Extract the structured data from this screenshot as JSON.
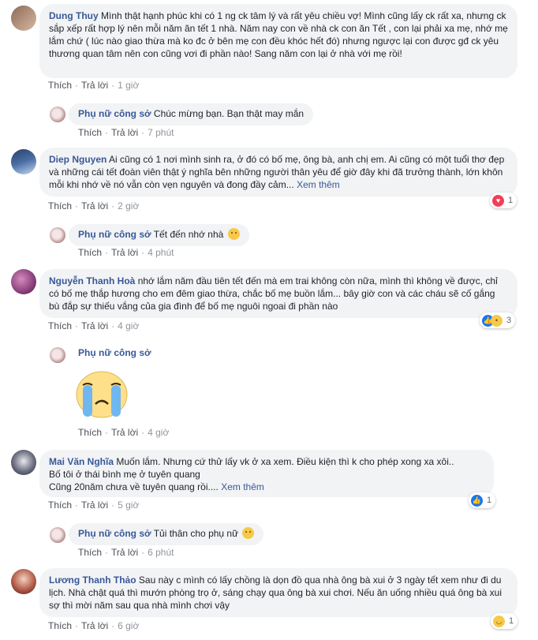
{
  "comments": [
    {
      "name": "Dung Thuy",
      "text": "Mình thật hạnh phúc khi có 1 ng ck tâm lý và rất yêu chiều vợ! Mình cũng lấy ck rất xa, nhưng ck sắp xếp rất hợp lý nên mỗi năm ăn tết 1 nhà. Năm nay con về nhà ck con ăn Tết , con lại phải xa mẹ, nhớ mẹ lắm chứ ( lúc nào giao thừa mà ko đc ở bên mẹ con đều khóc hết đó) nhưng ngược lại con được gđ ck yêu thương quan tâm nên con cũng vơi đi phần nào! Sang năm con lại ở nhà với mẹ rồi!",
      "like": "Thích",
      "reply": "Trả lời",
      "time": "1 giờ"
    },
    {
      "name": "Phụ nữ công sở",
      "text": "Chúc mừng bạn. Bạn thật may mắn",
      "like": "Thích",
      "reply": "Trả lời",
      "time": "7 phút"
    },
    {
      "name": "Diep Nguyen",
      "text": "Ai cũng có 1 nơi mình sinh ra, ở đó có bố mẹ, ông bà, anh chị em. Ai cũng có một tuổi thơ đẹp và những cái tết đoàn viên thật ý nghĩa bên những người thân yêu để giờ đây khi đã trưởng thành, lớn khôn mỗi khi nhớ về nó vẫn còn vẹn nguyên và đong đầy cảm...",
      "more": "Xem thêm",
      "like": "Thích",
      "reply": "Trả lời",
      "time": "2 giờ",
      "reaction_count": "1"
    },
    {
      "name": "Phụ nữ công sở",
      "text": "Tết đến nhớ nhà",
      "like": "Thích",
      "reply": "Trả lời",
      "time": "4 phút"
    },
    {
      "name": "Nguyễn Thanh Hoà",
      "text": "nhớ lắm năm đầu tiên tết đến mà em trai không còn nữa, mình thì không về được, chỉ có bố mẹ thắp hương cho em đêm giao thừa, chắc bố mẹ buồn lắm... bây giờ con và các cháu sẽ cố gắng bù đắp sự thiếu vắng của gia đình để bố mẹ nguôi ngoai đi phần nào",
      "like": "Thích",
      "reply": "Trả lời",
      "time": "4 giờ",
      "reaction_count": "3"
    },
    {
      "name": "Phụ nữ công sở",
      "like": "Thích",
      "reply": "Trả lời",
      "time": "4 giờ"
    },
    {
      "name": "Mai Văn Nghĩa",
      "line1": "Muốn lắm. Nhưng cứ thử lấy vk ở xa xem. Điều kiện thì k cho phép xong xa xôi..",
      "line2": "Bố tôi ở thái bình mẹ ở tuyên quang",
      "line3": "Cũng 20năm chưa về tuyên quang rồi....",
      "more": "Xem thêm",
      "like": "Thích",
      "reply": "Trả lời",
      "time": "5 giờ",
      "reaction_count": "1"
    },
    {
      "name": "Phụ nữ công sở",
      "text": "Tủi thân cho phụ nữ",
      "like": "Thích",
      "reply": "Trả lời",
      "time": "6 phút"
    },
    {
      "name": "Lương Thanh Thảo",
      "text": "Sau này c mình có lấy chồng là dọn đồ qua nhà ông bà xui ở 3 ngày tết xem như đi du lịch. Nhà chật quá thì mướn phòng trọ ở, sáng chạy qua ông bà xui chơi. Nếu ăn uống nhiều quá ông bà xui sợ thì mời năm sau qua nhà mình chơi vậy",
      "like": "Thích",
      "reply": "Trả lời",
      "time": "6 giờ",
      "reaction_count": "1"
    }
  ],
  "icons": {
    "heart": "heart-reaction-icon",
    "like": "like-reaction-icon",
    "sad": "sad-reaction-icon",
    "haha": "haha-reaction-icon",
    "crying_sticker": "crying-face-sticker"
  },
  "colors": {
    "name": "#385898",
    "bubble": "#f2f3f5",
    "meta": "#90949c",
    "heart": "#f33e58",
    "like": "#1877f2"
  }
}
